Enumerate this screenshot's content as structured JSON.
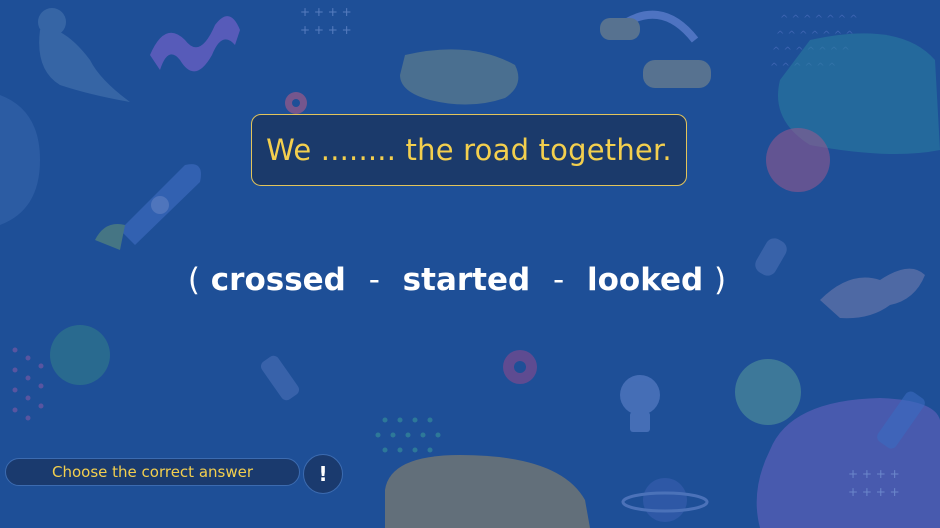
{
  "question": {
    "text": "We ........ the road together."
  },
  "options": {
    "open_paren": "(",
    "items": [
      "crossed",
      "started",
      "looked"
    ],
    "separator": "-",
    "close_paren": ")"
  },
  "footer": {
    "instruction": "Choose the correct answer",
    "hint_symbol": "!"
  },
  "colors": {
    "background": "#1e4f97",
    "accent": "#f3cf4e",
    "box_fill": "#1b3a6b"
  }
}
